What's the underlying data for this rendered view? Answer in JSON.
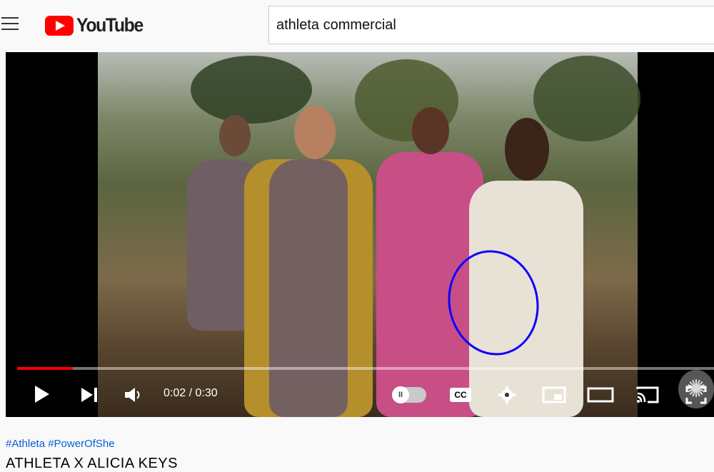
{
  "header": {
    "brand_text": "YouTube",
    "search_value": "athleta commercial"
  },
  "player": {
    "time_text": "0:02 / 0:30",
    "progress_fraction": 0.08,
    "captions_label": "CC",
    "autoplay_pause_symbol": "II",
    "icons": [
      "play-icon",
      "next-icon",
      "volume-icon",
      "autoplay-toggle",
      "captions-icon",
      "settings-icon",
      "miniplayer-icon",
      "theater-icon",
      "cast-icon",
      "fullscreen-icon"
    ],
    "overlay_annotation_color": "#0a00ff"
  },
  "video": {
    "hashtags": "#Athleta #PowerOfShe",
    "title": "ATHLETA X ALICIA KEYS"
  },
  "colors": {
    "brand_red": "#ff0000",
    "link_blue": "#065fd4"
  }
}
